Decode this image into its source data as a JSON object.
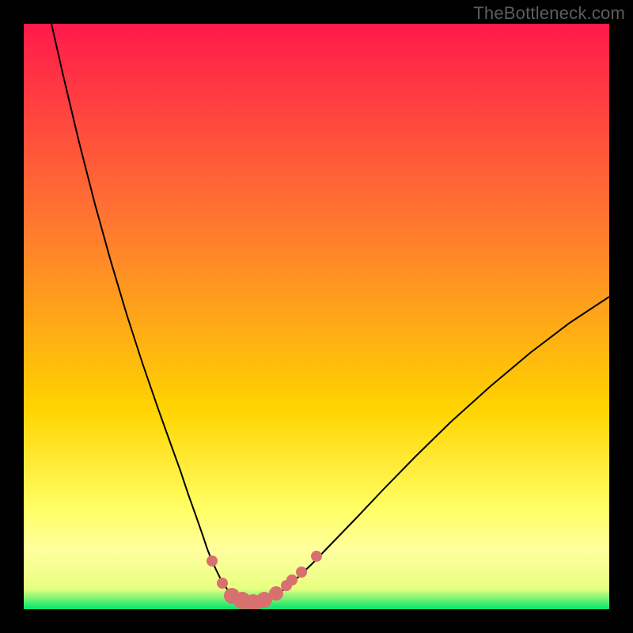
{
  "watermark": "TheBottleneck.com",
  "colors": {
    "frame": "#000000",
    "gradient_top": "#ff1a4b",
    "gradient_mid1": "#ff7a2f",
    "gradient_mid2": "#ffd400",
    "gradient_low": "#ffff66",
    "gradient_band": "#ffff9e",
    "gradient_green": "#00e66b",
    "curve_stroke": "#000000",
    "marker_fill": "#d87070"
  },
  "chart_data": {
    "type": "line",
    "title": "",
    "xlabel": "",
    "ylabel": "",
    "xlim": [
      30,
      770
    ],
    "ylim": [
      30,
      770
    ],
    "left_curve": {
      "x": [
        65,
        80,
        100,
        120,
        140,
        160,
        180,
        200,
        215,
        228,
        238,
        248,
        256,
        262,
        268,
        274,
        279,
        284,
        288,
        292
      ],
      "y": [
        30,
        96,
        180,
        258,
        330,
        397,
        459,
        517,
        559,
        595,
        625,
        653,
        676,
        694,
        709,
        722,
        732,
        740,
        746,
        750
      ]
    },
    "valley_curve": {
      "x": [
        292,
        298,
        305,
        313,
        320,
        328,
        336,
        344,
        352,
        360
      ],
      "y": [
        750,
        755,
        759,
        761,
        762,
        761,
        759,
        755,
        750,
        744
      ]
    },
    "right_curve": {
      "x": [
        360,
        375,
        395,
        420,
        450,
        485,
        525,
        570,
        620,
        670,
        720,
        770
      ],
      "y": [
        744,
        731,
        712,
        686,
        655,
        618,
        577,
        533,
        488,
        446,
        408,
        375
      ]
    },
    "markers": [
      {
        "x": 268,
        "y": 709,
        "r": 7
      },
      {
        "x": 281,
        "y": 737,
        "r": 7
      },
      {
        "x": 293,
        "y": 753,
        "r": 10
      },
      {
        "x": 306,
        "y": 759,
        "r": 11
      },
      {
        "x": 320,
        "y": 762,
        "r": 11
      },
      {
        "x": 334,
        "y": 758,
        "r": 10
      },
      {
        "x": 349,
        "y": 750,
        "r": 9
      },
      {
        "x": 362,
        "y": 740,
        "r": 7
      },
      {
        "x": 369,
        "y": 733,
        "r": 7
      },
      {
        "x": 381,
        "y": 723,
        "r": 7
      },
      {
        "x": 400,
        "y": 703,
        "r": 7
      }
    ]
  }
}
